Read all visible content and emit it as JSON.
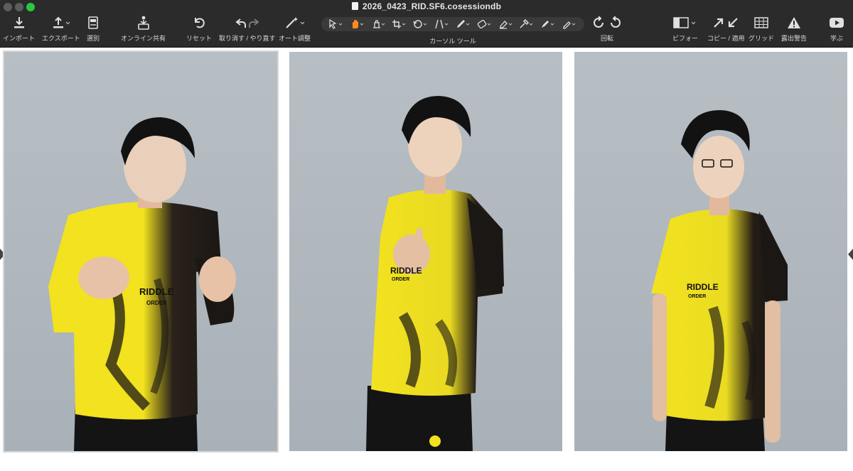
{
  "window": {
    "title": "2026_0423_RID.SF6.cosessiondb"
  },
  "toolbar": {
    "import_label": "インポート",
    "export_label": "エクスポート",
    "select_label": "選別",
    "online_share_label": "オンライン共有",
    "reset_label": "リセット",
    "undo_redo_label": "取り消す / やり直す",
    "auto_adjust_label": "オート調整",
    "cursor_tools_label": "カーソル ツール",
    "rotate_label": "回転",
    "before_label": "ビフォー",
    "copy_apply_label": "コピー / 適用",
    "grid_label": "グリッド",
    "exposure_warning_label": "露出警告",
    "learn_label": "学ぶ"
  },
  "photos": [
    {
      "jersey_text": "RIDDLE ORDER",
      "selected": true
    },
    {
      "jersey_text": "RIDDLE ORDER",
      "selected": false
    },
    {
      "jersey_text": "RIDDLE ORDER",
      "selected": false
    }
  ],
  "colors": {
    "toolbar_bg": "#2b2b2b",
    "backdrop": "#aab2b9",
    "jersey_yellow": "#f2e21f",
    "jersey_black": "#1b1714",
    "accent_green": "#28c840"
  }
}
